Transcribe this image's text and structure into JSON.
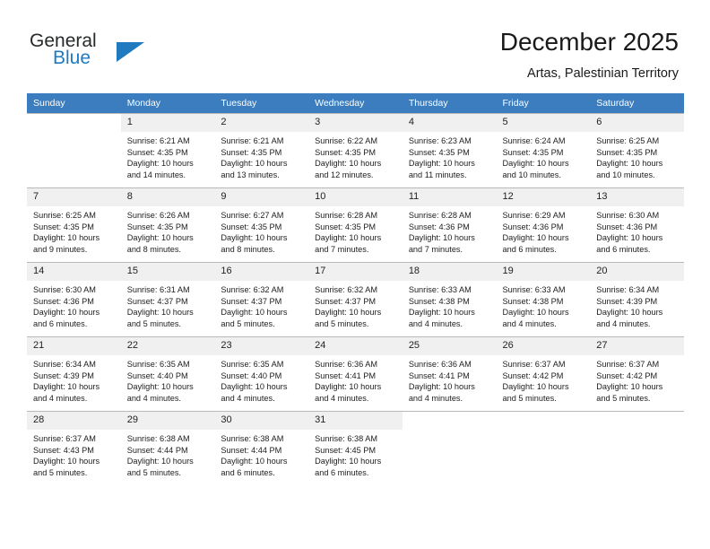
{
  "brand": {
    "name_line1": "General",
    "name_line2": "Blue",
    "accent_color": "#1f7ac0",
    "logo_icon": "triangle-flag-icon"
  },
  "header": {
    "month_title": "December 2025",
    "location": "Artas, Palestinian Territory"
  },
  "calendar": {
    "header_bg": "#3b7dbf",
    "daynum_bg": "#f0f0f0",
    "weekdays": [
      "Sunday",
      "Monday",
      "Tuesday",
      "Wednesday",
      "Thursday",
      "Friday",
      "Saturday"
    ],
    "weeks": [
      [
        {
          "day": "",
          "sunrise": "",
          "sunset": "",
          "daylight1": "",
          "daylight2": ""
        },
        {
          "day": "1",
          "sunrise": "Sunrise: 6:21 AM",
          "sunset": "Sunset: 4:35 PM",
          "daylight1": "Daylight: 10 hours",
          "daylight2": "and 14 minutes."
        },
        {
          "day": "2",
          "sunrise": "Sunrise: 6:21 AM",
          "sunset": "Sunset: 4:35 PM",
          "daylight1": "Daylight: 10 hours",
          "daylight2": "and 13 minutes."
        },
        {
          "day": "3",
          "sunrise": "Sunrise: 6:22 AM",
          "sunset": "Sunset: 4:35 PM",
          "daylight1": "Daylight: 10 hours",
          "daylight2": "and 12 minutes."
        },
        {
          "day": "4",
          "sunrise": "Sunrise: 6:23 AM",
          "sunset": "Sunset: 4:35 PM",
          "daylight1": "Daylight: 10 hours",
          "daylight2": "and 11 minutes."
        },
        {
          "day": "5",
          "sunrise": "Sunrise: 6:24 AM",
          "sunset": "Sunset: 4:35 PM",
          "daylight1": "Daylight: 10 hours",
          "daylight2": "and 10 minutes."
        },
        {
          "day": "6",
          "sunrise": "Sunrise: 6:25 AM",
          "sunset": "Sunset: 4:35 PM",
          "daylight1": "Daylight: 10 hours",
          "daylight2": "and 10 minutes."
        }
      ],
      [
        {
          "day": "7",
          "sunrise": "Sunrise: 6:25 AM",
          "sunset": "Sunset: 4:35 PM",
          "daylight1": "Daylight: 10 hours",
          "daylight2": "and 9 minutes."
        },
        {
          "day": "8",
          "sunrise": "Sunrise: 6:26 AM",
          "sunset": "Sunset: 4:35 PM",
          "daylight1": "Daylight: 10 hours",
          "daylight2": "and 8 minutes."
        },
        {
          "day": "9",
          "sunrise": "Sunrise: 6:27 AM",
          "sunset": "Sunset: 4:35 PM",
          "daylight1": "Daylight: 10 hours",
          "daylight2": "and 8 minutes."
        },
        {
          "day": "10",
          "sunrise": "Sunrise: 6:28 AM",
          "sunset": "Sunset: 4:35 PM",
          "daylight1": "Daylight: 10 hours",
          "daylight2": "and 7 minutes."
        },
        {
          "day": "11",
          "sunrise": "Sunrise: 6:28 AM",
          "sunset": "Sunset: 4:36 PM",
          "daylight1": "Daylight: 10 hours",
          "daylight2": "and 7 minutes."
        },
        {
          "day": "12",
          "sunrise": "Sunrise: 6:29 AM",
          "sunset": "Sunset: 4:36 PM",
          "daylight1": "Daylight: 10 hours",
          "daylight2": "and 6 minutes."
        },
        {
          "day": "13",
          "sunrise": "Sunrise: 6:30 AM",
          "sunset": "Sunset: 4:36 PM",
          "daylight1": "Daylight: 10 hours",
          "daylight2": "and 6 minutes."
        }
      ],
      [
        {
          "day": "14",
          "sunrise": "Sunrise: 6:30 AM",
          "sunset": "Sunset: 4:36 PM",
          "daylight1": "Daylight: 10 hours",
          "daylight2": "and 6 minutes."
        },
        {
          "day": "15",
          "sunrise": "Sunrise: 6:31 AM",
          "sunset": "Sunset: 4:37 PM",
          "daylight1": "Daylight: 10 hours",
          "daylight2": "and 5 minutes."
        },
        {
          "day": "16",
          "sunrise": "Sunrise: 6:32 AM",
          "sunset": "Sunset: 4:37 PM",
          "daylight1": "Daylight: 10 hours",
          "daylight2": "and 5 minutes."
        },
        {
          "day": "17",
          "sunrise": "Sunrise: 6:32 AM",
          "sunset": "Sunset: 4:37 PM",
          "daylight1": "Daylight: 10 hours",
          "daylight2": "and 5 minutes."
        },
        {
          "day": "18",
          "sunrise": "Sunrise: 6:33 AM",
          "sunset": "Sunset: 4:38 PM",
          "daylight1": "Daylight: 10 hours",
          "daylight2": "and 4 minutes."
        },
        {
          "day": "19",
          "sunrise": "Sunrise: 6:33 AM",
          "sunset": "Sunset: 4:38 PM",
          "daylight1": "Daylight: 10 hours",
          "daylight2": "and 4 minutes."
        },
        {
          "day": "20",
          "sunrise": "Sunrise: 6:34 AM",
          "sunset": "Sunset: 4:39 PM",
          "daylight1": "Daylight: 10 hours",
          "daylight2": "and 4 minutes."
        }
      ],
      [
        {
          "day": "21",
          "sunrise": "Sunrise: 6:34 AM",
          "sunset": "Sunset: 4:39 PM",
          "daylight1": "Daylight: 10 hours",
          "daylight2": "and 4 minutes."
        },
        {
          "day": "22",
          "sunrise": "Sunrise: 6:35 AM",
          "sunset": "Sunset: 4:40 PM",
          "daylight1": "Daylight: 10 hours",
          "daylight2": "and 4 minutes."
        },
        {
          "day": "23",
          "sunrise": "Sunrise: 6:35 AM",
          "sunset": "Sunset: 4:40 PM",
          "daylight1": "Daylight: 10 hours",
          "daylight2": "and 4 minutes."
        },
        {
          "day": "24",
          "sunrise": "Sunrise: 6:36 AM",
          "sunset": "Sunset: 4:41 PM",
          "daylight1": "Daylight: 10 hours",
          "daylight2": "and 4 minutes."
        },
        {
          "day": "25",
          "sunrise": "Sunrise: 6:36 AM",
          "sunset": "Sunset: 4:41 PM",
          "daylight1": "Daylight: 10 hours",
          "daylight2": "and 4 minutes."
        },
        {
          "day": "26",
          "sunrise": "Sunrise: 6:37 AM",
          "sunset": "Sunset: 4:42 PM",
          "daylight1": "Daylight: 10 hours",
          "daylight2": "and 5 minutes."
        },
        {
          "day": "27",
          "sunrise": "Sunrise: 6:37 AM",
          "sunset": "Sunset: 4:42 PM",
          "daylight1": "Daylight: 10 hours",
          "daylight2": "and 5 minutes."
        }
      ],
      [
        {
          "day": "28",
          "sunrise": "Sunrise: 6:37 AM",
          "sunset": "Sunset: 4:43 PM",
          "daylight1": "Daylight: 10 hours",
          "daylight2": "and 5 minutes."
        },
        {
          "day": "29",
          "sunrise": "Sunrise: 6:38 AM",
          "sunset": "Sunset: 4:44 PM",
          "daylight1": "Daylight: 10 hours",
          "daylight2": "and 5 minutes."
        },
        {
          "day": "30",
          "sunrise": "Sunrise: 6:38 AM",
          "sunset": "Sunset: 4:44 PM",
          "daylight1": "Daylight: 10 hours",
          "daylight2": "and 6 minutes."
        },
        {
          "day": "31",
          "sunrise": "Sunrise: 6:38 AM",
          "sunset": "Sunset: 4:45 PM",
          "daylight1": "Daylight: 10 hours",
          "daylight2": "and 6 minutes."
        },
        {
          "day": "",
          "sunrise": "",
          "sunset": "",
          "daylight1": "",
          "daylight2": ""
        },
        {
          "day": "",
          "sunrise": "",
          "sunset": "",
          "daylight1": "",
          "daylight2": ""
        },
        {
          "day": "",
          "sunrise": "",
          "sunset": "",
          "daylight1": "",
          "daylight2": ""
        }
      ]
    ]
  }
}
